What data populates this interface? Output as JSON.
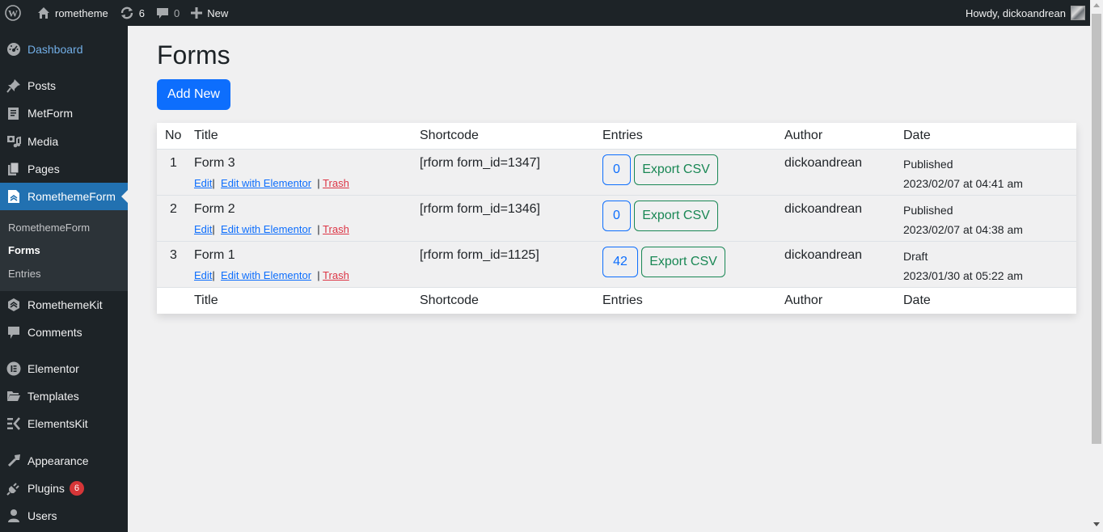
{
  "adminbar": {
    "site_name": "rometheme",
    "updates_count": "6",
    "comments_count": "0",
    "new_label": "New",
    "howdy": "Howdy, dickoandrean"
  },
  "sidebar": {
    "items": [
      {
        "label": "Dashboard",
        "icon": "dashboard-icon"
      },
      {
        "label": "Posts",
        "icon": "pin-icon"
      },
      {
        "label": "MetForm",
        "icon": "form-icon"
      },
      {
        "label": "Media",
        "icon": "media-icon"
      },
      {
        "label": "Pages",
        "icon": "pages-icon"
      },
      {
        "label": "RomethemeForm",
        "icon": "rometheme-form-icon"
      },
      {
        "label": "RomethemeKit",
        "icon": "rometheme-kit-icon"
      },
      {
        "label": "Comments",
        "icon": "comment-icon"
      },
      {
        "label": "Elementor",
        "icon": "elementor-icon"
      },
      {
        "label": "Templates",
        "icon": "folder-icon"
      },
      {
        "label": "ElementsKit",
        "icon": "elementskit-icon"
      },
      {
        "label": "Appearance",
        "icon": "brush-icon"
      },
      {
        "label": "Plugins",
        "icon": "plug-icon",
        "badge": "6"
      },
      {
        "label": "Users",
        "icon": "user-icon"
      }
    ],
    "submenu": [
      "RomethemeForm",
      "Forms",
      "Entries"
    ]
  },
  "main": {
    "title": "Forms",
    "add_new_label": "Add New",
    "table": {
      "headers": [
        "No",
        "Title",
        "Shortcode",
        "Entries",
        "Author",
        "Date"
      ],
      "footers": [
        "Title",
        "Shortcode",
        "Entries",
        "Author",
        "Date"
      ],
      "row_actions": {
        "edit": "Edit",
        "edit_elementor": "Edit with Elementor",
        "trash": "Trash",
        "sep": "|"
      },
      "export_label": "Export CSV",
      "rows": [
        {
          "no": "1",
          "title": "Form 3",
          "shortcode": "[rform form_id=1347]",
          "entries": "0",
          "author": "dickoandrean",
          "status": "Published",
          "date": "2023/02/07 at 04:41 am"
        },
        {
          "no": "2",
          "title": "Form 2",
          "shortcode": "[rform form_id=1346]",
          "entries": "0",
          "author": "dickoandrean",
          "status": "Published",
          "date": "2023/02/07 at 04:38 am"
        },
        {
          "no": "3",
          "title": "Form 1",
          "shortcode": "[rform form_id=1125]",
          "entries": "42",
          "author": "dickoandrean",
          "status": "Draft",
          "date": "2023/01/30 at 05:22 am"
        }
      ]
    }
  },
  "colors": {
    "adminbar_bg": "#1d2327",
    "active_menu": "#2271b1",
    "primary": "#0d6efd",
    "success": "#198754",
    "danger": "#dc3545",
    "badge": "#d63638"
  }
}
